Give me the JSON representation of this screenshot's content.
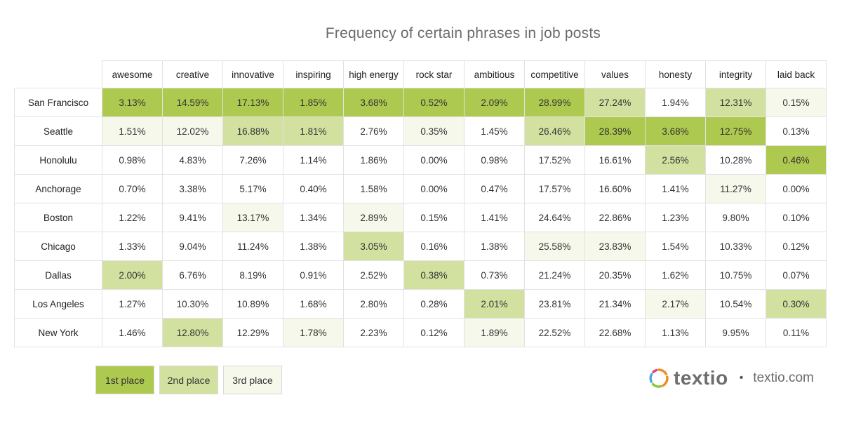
{
  "chart_data": {
    "type": "table",
    "title": "Frequency of certain phrases in job posts",
    "columns": [
      "awesome",
      "creative",
      "innovative",
      "inspiring",
      "high energy",
      "rock star",
      "ambitious",
      "competitive",
      "values",
      "honesty",
      "integrity",
      "laid back"
    ],
    "rows": [
      {
        "city": "San Francisco",
        "values": [
          "3.13%",
          "14.59%",
          "17.13%",
          "1.85%",
          "3.68%",
          "0.52%",
          "2.09%",
          "28.99%",
          "27.24%",
          "1.94%",
          "12.31%",
          "0.15%"
        ],
        "ranks": [
          1,
          1,
          1,
          1,
          1,
          1,
          1,
          1,
          2,
          0,
          2,
          3
        ]
      },
      {
        "city": "Seattle",
        "values": [
          "1.51%",
          "12.02%",
          "16.88%",
          "1.81%",
          "2.76%",
          "0.35%",
          "1.45%",
          "26.46%",
          "28.39%",
          "3.68%",
          "12.75%",
          "0.13%"
        ],
        "ranks": [
          3,
          3,
          2,
          2,
          0,
          3,
          0,
          2,
          1,
          1,
          1,
          0
        ]
      },
      {
        "city": "Honolulu",
        "values": [
          "0.98%",
          "4.83%",
          "7.26%",
          "1.14%",
          "1.86%",
          "0.00%",
          "0.98%",
          "17.52%",
          "16.61%",
          "2.56%",
          "10.28%",
          "0.46%"
        ],
        "ranks": [
          0,
          0,
          0,
          0,
          0,
          0,
          0,
          0,
          0,
          2,
          0,
          1
        ]
      },
      {
        "city": "Anchorage",
        "values": [
          "0.70%",
          "3.38%",
          "5.17%",
          "0.40%",
          "1.58%",
          "0.00%",
          "0.47%",
          "17.57%",
          "16.60%",
          "1.41%",
          "11.27%",
          "0.00%"
        ],
        "ranks": [
          0,
          0,
          0,
          0,
          0,
          0,
          0,
          0,
          0,
          0,
          3,
          0
        ]
      },
      {
        "city": "Boston",
        "values": [
          "1.22%",
          "9.41%",
          "13.17%",
          "1.34%",
          "2.89%",
          "0.15%",
          "1.41%",
          "24.64%",
          "22.86%",
          "1.23%",
          "9.80%",
          "0.10%"
        ],
        "ranks": [
          0,
          0,
          3,
          0,
          3,
          0,
          0,
          0,
          0,
          0,
          0,
          0
        ]
      },
      {
        "city": "Chicago",
        "values": [
          "1.33%",
          "9.04%",
          "11.24%",
          "1.38%",
          "3.05%",
          "0.16%",
          "1.38%",
          "25.58%",
          "23.83%",
          "1.54%",
          "10.33%",
          "0.12%"
        ],
        "ranks": [
          0,
          0,
          0,
          0,
          2,
          0,
          0,
          3,
          3,
          0,
          0,
          0
        ]
      },
      {
        "city": "Dallas",
        "values": [
          "2.00%",
          "6.76%",
          "8.19%",
          "0.91%",
          "2.52%",
          "0.38%",
          "0.73%",
          "21.24%",
          "20.35%",
          "1.62%",
          "10.75%",
          "0.07%"
        ],
        "ranks": [
          2,
          0,
          0,
          0,
          0,
          2,
          0,
          0,
          0,
          0,
          0,
          0
        ]
      },
      {
        "city": "Los Angeles",
        "values": [
          "1.27%",
          "10.30%",
          "10.89%",
          "1.68%",
          "2.80%",
          "0.28%",
          "2.01%",
          "23.81%",
          "21.34%",
          "2.17%",
          "10.54%",
          "0.30%"
        ],
        "ranks": [
          0,
          0,
          0,
          0,
          0,
          0,
          2,
          0,
          0,
          3,
          0,
          2
        ]
      },
      {
        "city": "New York",
        "values": [
          "1.46%",
          "12.80%",
          "12.29%",
          "1.78%",
          "2.23%",
          "0.12%",
          "1.89%",
          "22.52%",
          "22.68%",
          "1.13%",
          "9.95%",
          "0.11%"
        ],
        "ranks": [
          0,
          2,
          0,
          3,
          0,
          0,
          3,
          0,
          0,
          0,
          0,
          0
        ]
      }
    ],
    "legend": [
      {
        "label": "1st place",
        "color": "#aec94f"
      },
      {
        "label": "2nd place",
        "color": "#d3e1a0"
      },
      {
        "label": "3rd place",
        "color": "#f5f8ea"
      }
    ],
    "legend_position": "bottom-left"
  },
  "branding": {
    "logo_icon": "textio-ring-logo-icon",
    "wordmark": "textio",
    "separator": "•",
    "url": "textio.com",
    "logo_colors": [
      "#e0457b",
      "#f28c28",
      "#8cc63f",
      "#4fa9e0"
    ]
  }
}
